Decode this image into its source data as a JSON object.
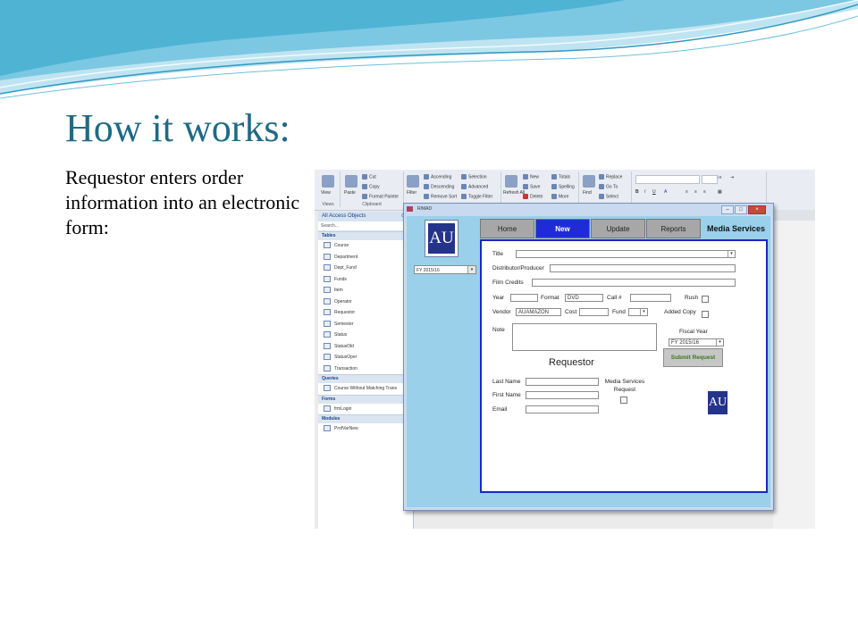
{
  "slide": {
    "title": "How it works:",
    "body": "Requestor enters order information into an electronic form:"
  },
  "colors": {
    "title": "#1f6a85",
    "wave": "#4fb3d4",
    "active_tab": "#1f2bd6",
    "form_bg": "#9ad0ea",
    "submit_text": "#3b7a1a"
  },
  "ribbon": {
    "views": {
      "view": "View",
      "group": "Views"
    },
    "clipboard": {
      "paste": "Paste",
      "cut": "Cut",
      "copy": "Copy",
      "format_painter": "Format Painter",
      "group": "Clipboard"
    },
    "sort": {
      "filter": "Filter",
      "ascending": "Ascending",
      "descending": "Descending",
      "remove_sort": "Remove Sort",
      "selection": "Selection",
      "advanced": "Advanced",
      "toggle_filter": "Toggle Filter"
    },
    "records": {
      "refresh": "Refresh All",
      "new": "New",
      "save": "Save",
      "delete": "Delete",
      "totals": "Totals",
      "spelling": "Spelling",
      "more": "More"
    },
    "find": {
      "find": "Find",
      "replace": "Replace",
      "goto": "Go To",
      "select": "Select"
    }
  },
  "nav": {
    "header": "All Access Objects",
    "search": "Search...",
    "tables_label": "Tables",
    "tables": [
      "Course",
      "Department",
      "Dept_Fund",
      "Funds",
      "Item",
      "Operator",
      "Requestor",
      "Semester",
      "Status",
      "StatusOld",
      "StatusOper",
      "Transaction"
    ],
    "queries_label": "Queries",
    "queries": [
      "Course Without Matching Trans"
    ],
    "forms_label": "Forms",
    "forms": [
      "frmLogin"
    ],
    "modules_label": "Modules",
    "modules": [
      "ProfVarNew"
    ]
  },
  "window": {
    "title": "R/MAD",
    "minimize": "–",
    "restore": "□",
    "close": "×"
  },
  "form": {
    "logo_text": "AU",
    "fiscal_year_combo": "FY 2015/16",
    "tabs": [
      "Home",
      "New",
      "Update",
      "Reports"
    ],
    "tab_caption": "Media Services",
    "labels": {
      "title": "Title",
      "distributor": "Distributor/Producer",
      "film_credits": "Film Credits",
      "year": "Year",
      "format": "Format",
      "call": "Call #",
      "rush": "Rush",
      "vendor": "Vendor",
      "cost": "Cost",
      "fund": "Fund",
      "added_copy": "Added Copy",
      "note": "Note",
      "fiscal_year": "Fiscal Year",
      "requestor": "Requestor",
      "last_name": "Last Name",
      "first_name": "First Name",
      "email": "Email",
      "media_services_request": "Media Services Request"
    },
    "values": {
      "format": "DVD",
      "vendor": "AUAMAZON",
      "fiscal_year": "FY 2015/16"
    },
    "submit": "Submit Request"
  }
}
